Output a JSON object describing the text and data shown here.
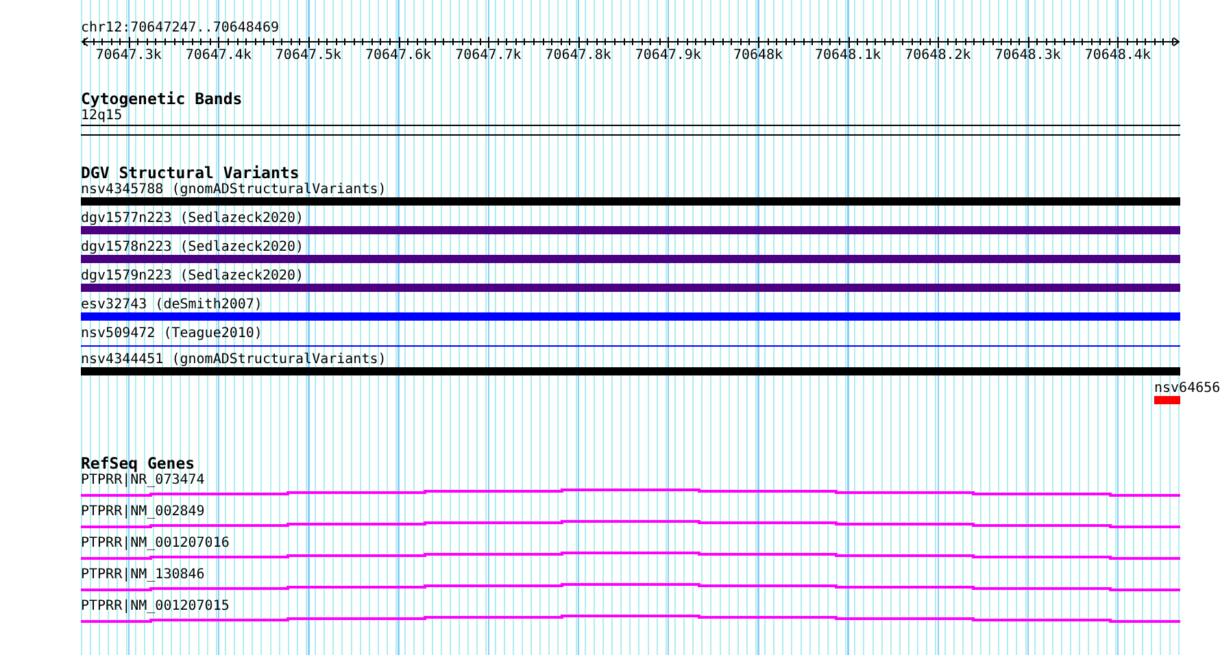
{
  "region": "chr12:70647247..70648469",
  "ruler": {
    "ticks": [
      "70647.3k",
      "70647.4k",
      "70647.5k",
      "70647.6k",
      "70647.7k",
      "70647.8k",
      "70647.9k",
      "70648k",
      "70648.1k",
      "70648.2k",
      "70648.3k",
      "70648.4k"
    ]
  },
  "tracks": [
    {
      "kind": "cytoband",
      "title": "Cytogenetic Bands",
      "features": [
        {
          "label": "12q15"
        }
      ]
    },
    {
      "kind": "variants",
      "title": "DGV Structural Variants",
      "features": [
        {
          "label": "nsv4345788 (gnomADStructuralVariants)",
          "kind": "bar",
          "color": "#000000"
        },
        {
          "label": "dgv1577n223 (Sedlazeck2020)",
          "kind": "bar",
          "color": "#4b0082"
        },
        {
          "label": "dgv1578n223 (Sedlazeck2020)",
          "kind": "bar",
          "color": "#4b0082"
        },
        {
          "label": "dgv1579n223 (Sedlazeck2020)",
          "kind": "bar",
          "color": "#4b0082"
        },
        {
          "label": "esv32743 (deSmith2007)",
          "kind": "bar",
          "color": "#0000ff"
        },
        {
          "label": "nsv509472 (Teague2010)",
          "kind": "line",
          "color": "#0000ff"
        },
        {
          "label": "nsv4344451 (gnomADStructuralVariants)",
          "kind": "bar",
          "color": "#000000"
        },
        {
          "label": "nsv64656",
          "kind": "edge",
          "color": "#ff0000"
        }
      ]
    },
    {
      "kind": "genes",
      "title": "RefSeq Genes",
      "features": [
        {
          "label": "PTPRR|NR_073474"
        },
        {
          "label": "PTPRR|NM_002849"
        },
        {
          "label": "PTPRR|NM_001207016"
        },
        {
          "label": "PTPRR|NM_130846"
        },
        {
          "label": "PTPRR|NM_001207015"
        }
      ]
    }
  ]
}
